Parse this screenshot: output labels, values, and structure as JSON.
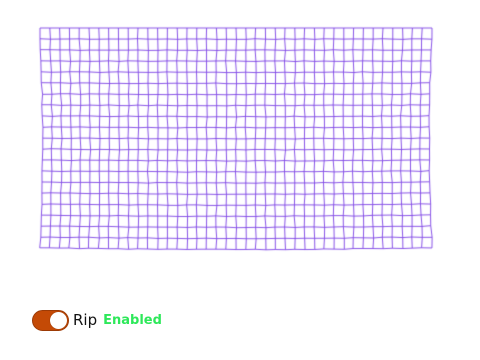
{
  "simulation": {
    "mesh_color": "#7b3fe4",
    "background": "#ffffff"
  },
  "controls": {
    "rip_toggle": {
      "label": "Rip",
      "state": true,
      "track_color": "#c44a06",
      "knob_color": "#ffffff"
    },
    "status": {
      "text": "Enabled",
      "color": "#2ee85a"
    }
  }
}
